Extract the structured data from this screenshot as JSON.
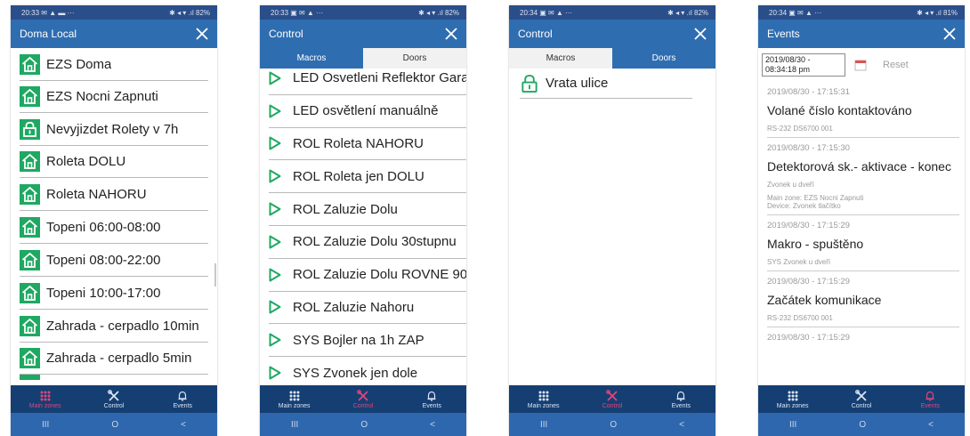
{
  "phones": [
    {
      "status": {
        "time": "20:33",
        "icons": "✉ ▲ ▬ ···",
        "right": "✱ ◂ ▾ .ıl 82%"
      },
      "title": "Doma Local",
      "items": [
        "EZS Doma",
        "EZS Nocni Zapnuti",
        "Nevyjizdet Rolety v 7h",
        "Roleta DOLU",
        "Roleta NAHORU",
        "Topeni 06:00-08:00",
        "Topeni 08:00-22:00",
        "Topeni 10:00-17:00",
        "Zahrada - cerpadlo 10min",
        "Zahrada - cerpadlo 5min"
      ],
      "item_icons": [
        "home-icon",
        "home-icon",
        "lock-icon",
        "home-icon",
        "home-icon",
        "home-icon",
        "home-icon",
        "home-icon",
        "home-icon",
        "home-icon"
      ]
    },
    {
      "status": {
        "time": "20:33",
        "icons": "▣ ✉ ▲ ···",
        "right": "✱ ◂ ▾ .ıl 82%"
      },
      "title": "Control",
      "tabs": [
        "Macros",
        "Doors"
      ],
      "items": [
        "LED Osvetleni Reflektor Garaz",
        "LED osvětlení manuálně",
        "ROL Roleta NAHORU",
        "ROL Roleta jen DOLU",
        "ROL Zaluzie Dolu",
        "ROL Zaluzie Dolu 30stupnu",
        "ROL Zaluzie Dolu ROVNE 90",
        "ROL Zaluzie Nahoru",
        "SYS Bojler na 1h ZAP",
        "SYS Zvonek jen dole"
      ]
    },
    {
      "status": {
        "time": "20:34",
        "icons": "▣ ✉ ▲ ···",
        "right": "✱ ◂ ▾ .ıl 82%"
      },
      "title": "Control",
      "tabs": [
        "Macros",
        "Doors"
      ],
      "doors": [
        "Vrata ulice"
      ]
    },
    {
      "status": {
        "time": "20:34",
        "icons": "▣ ✉ ▲ ···",
        "right": "✱ ◂ ▾ .ıl 81%"
      },
      "title": "Events",
      "filter_date": "2019/08/30 - 08:34:18 pm",
      "reset_label": "Reset",
      "events": [
        {
          "date": "2019/08/30 - 17:15:31",
          "title": "Volané číslo kontaktováno",
          "sub": [
            "RS-232 DS6700 001"
          ]
        },
        {
          "date": "2019/08/30 - 17:15:30",
          "title": "Detektorová sk.- aktivace - konec",
          "sub": [
            "Zvonek u dveří",
            "Main zone: EZS Nocni Zapnuti",
            "Device: Zvonek tlačítko"
          ]
        },
        {
          "date": "2019/08/30 - 17:15:29",
          "title": "Makro - spuštěno",
          "sub": [
            "SYS Zvonek u dveří"
          ]
        },
        {
          "date": "2019/08/30 - 17:15:29",
          "title": "Začátek komunikace",
          "sub": [
            "RS-232 DS6700 001"
          ]
        },
        {
          "date": "2019/08/30 - 17:15:29",
          "title": "",
          "sub": []
        }
      ]
    }
  ],
  "nav": {
    "main_zones": "Main zones",
    "control": "Control",
    "events": "Events"
  },
  "sysnav": {
    "recent": "III",
    "home": "O",
    "back": "<"
  },
  "colors": {
    "primary": "#2f6db1",
    "status": "#2a4e8a",
    "nav": "#153f73",
    "active": "#e0457b",
    "icon_green": "#1fa862",
    "sysbar": "#2e67ad"
  }
}
